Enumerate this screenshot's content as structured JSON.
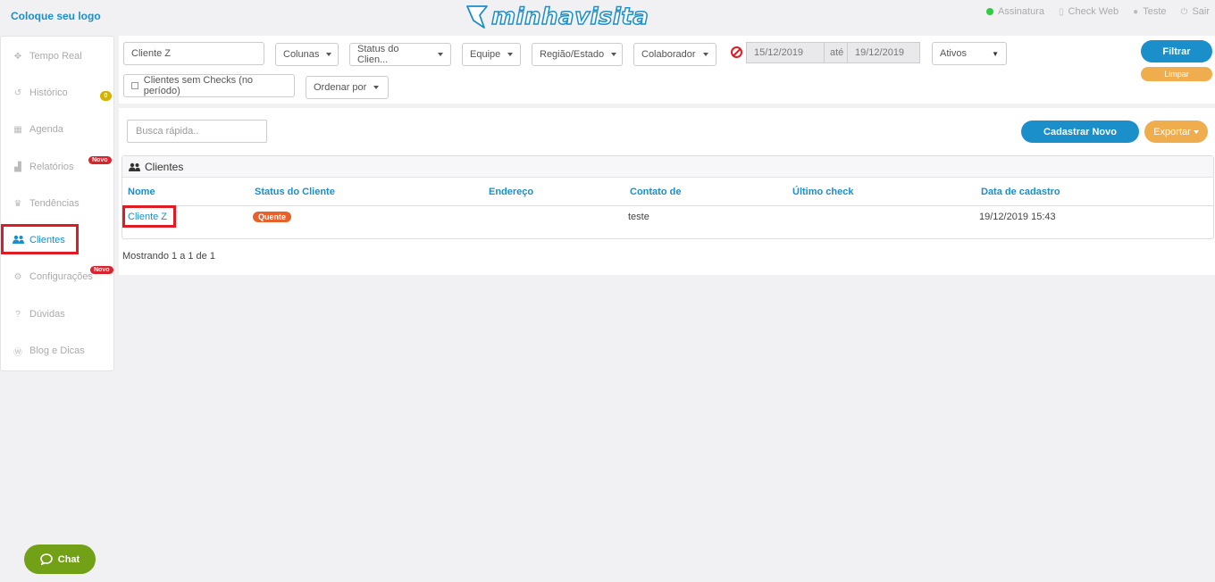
{
  "header": {
    "brand_text": "Coloque seu logo",
    "logo_text": "minhavisita",
    "links": [
      {
        "label": "Assinatura",
        "icon": "green-dot"
      },
      {
        "label": "Check Web",
        "icon": "mobile-icon"
      },
      {
        "label": "Teste",
        "icon": "user-icon"
      },
      {
        "label": "Sair",
        "icon": "power-icon"
      }
    ]
  },
  "sidebar": {
    "items": [
      {
        "label": "Tempo Real",
        "icon": "crosshair-icon",
        "glyph": "✥"
      },
      {
        "label": "Histórico",
        "icon": "history-icon",
        "glyph": "↺"
      },
      {
        "label": "Agenda",
        "icon": "calendar-icon",
        "glyph": "▦"
      },
      {
        "label": "Relatórios",
        "icon": "area-chart-icon",
        "glyph": "▟"
      },
      {
        "label": "Tendências",
        "icon": "trophy-icon",
        "glyph": "♛"
      },
      {
        "label": "Clientes",
        "icon": "users-icon",
        "glyph": "👥"
      },
      {
        "label": "Configurações",
        "icon": "cogs-icon",
        "glyph": "⚙"
      },
      {
        "label": "Dúvidas",
        "icon": "question-icon",
        "glyph": "?"
      },
      {
        "label": "Blog e Dicas",
        "icon": "wordpress-icon",
        "glyph": "Ⓦ"
      }
    ],
    "badge_historico": "0",
    "badge_new": "Novo"
  },
  "filters": {
    "client_value": "Cliente Z",
    "colunas": "Colunas",
    "status": "Status do Clien...",
    "equipe": "Equipe",
    "regiao": "Região/Estado",
    "colaborador": "Colaborador",
    "date_from": "15/12/2019",
    "date_sep": "até",
    "date_to": "19/12/2019",
    "ativos": "Ativos",
    "sem_checks": "Clientes sem Checks (no período)",
    "ordenar": "Ordenar por",
    "filtrar": "Filtrar",
    "limpar": "Limpar"
  },
  "content": {
    "search_placeholder": "Busca rápida..",
    "cadastrar": "Cadastrar Novo",
    "exportar": "Exportar",
    "table_title": "Clientes",
    "columns": [
      "Nome",
      "Status do Cliente",
      "Endereço",
      "Contato de",
      "Último check",
      "Data de cadastro"
    ],
    "rows": [
      {
        "nome": "Cliente Z",
        "status": "Quente",
        "endereco": "",
        "contato": "teste",
        "ultimo_check": "",
        "data_cadastro": "19/12/2019 15:43"
      }
    ],
    "footer": "Mostrando 1 a 1 de 1"
  },
  "chat": {
    "label": "Chat"
  },
  "colors": {
    "accent": "#1a8fc9",
    "orange": "#f0ad4e",
    "highlight": "#e01b24",
    "chat": "#72a017"
  }
}
